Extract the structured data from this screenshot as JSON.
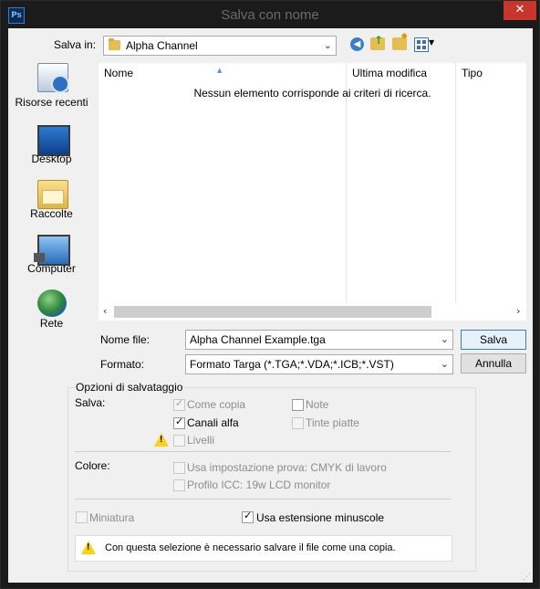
{
  "window": {
    "title": "Salva con nome",
    "app_icon_text": "Ps",
    "close_glyph": "✕"
  },
  "toolbar": {
    "save_in_label": "Salva in:",
    "save_in_value": "Alpha Channel",
    "icons": [
      "back-icon",
      "up-folder-icon",
      "new-folder-icon",
      "view-menu-icon"
    ]
  },
  "places": [
    {
      "label": "Risorse recenti",
      "icon": "recent-places-icon"
    },
    {
      "label": "Desktop",
      "icon": "desktop-icon"
    },
    {
      "label": "Raccolte",
      "icon": "libraries-icon"
    },
    {
      "label": "Computer",
      "icon": "computer-icon"
    },
    {
      "label": "Rete",
      "icon": "network-icon"
    }
  ],
  "file_list": {
    "columns": [
      "Nome",
      "Ultima modifica",
      "Tipo"
    ],
    "empty_message": "Nessun elemento corrisponde ai criteri di ricerca."
  },
  "form": {
    "filename_label": "Nome file:",
    "filename_value": "Alpha Channel Example.tga",
    "format_label": "Formato:",
    "format_value": "Formato Targa (*.TGA;*.VDA;*.ICB;*.VST)",
    "save_button": "Salva",
    "cancel_button": "Annulla"
  },
  "options": {
    "group_title": "Opzioni di salvataggio",
    "save_label": "Salva:",
    "as_copy": {
      "label": "Come copia",
      "checked": true,
      "disabled": true
    },
    "alpha_channels": {
      "label": "Canali alfa",
      "checked": true,
      "disabled": false
    },
    "layers": {
      "label": "Livelli",
      "checked": false,
      "disabled": true
    },
    "notes": {
      "label": "Note",
      "checked": false,
      "disabled": true
    },
    "spot_colors": {
      "label": "Tinte piatte",
      "checked": false,
      "disabled": true
    },
    "color_label": "Colore:",
    "use_proof_setup": {
      "label": "Usa impostazione prova:  CMYK di lavoro",
      "checked": false,
      "disabled": true
    },
    "icc_profile": {
      "label": "Profilo ICC:  19w LCD monitor",
      "checked": false,
      "disabled": true
    },
    "thumbnail": {
      "label": "Miniatura",
      "checked": false,
      "disabled": true
    },
    "lowercase_ext": {
      "label": "Usa estensione minuscole",
      "checked": true,
      "disabled": false
    },
    "warning_message": "Con questa selezione è necessario salvare il file come una copia."
  }
}
